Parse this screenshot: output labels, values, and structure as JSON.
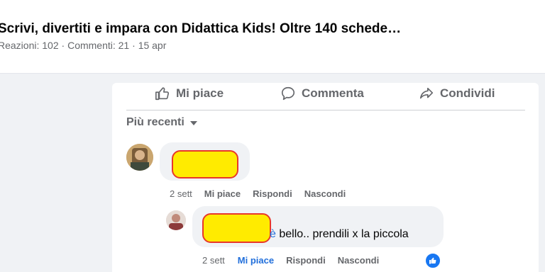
{
  "post": {
    "title": "Scrivi, divertiti e impara con Didattica Kids! Oltre 140 schede…",
    "reactions": "Reazioni: 102",
    "comments": "Commenti: 21",
    "date": "15 apr",
    "separator": "·"
  },
  "actions": {
    "like": "Mi piace",
    "comment": "Commenta",
    "share": "Condividi"
  },
  "sort": {
    "label": "Più recenti"
  },
  "comments": [
    {
      "time": "2 sett",
      "like": "Mi piace",
      "reply": "Rispondi",
      "hide": "Nascondi"
    },
    {
      "text_link_tail": "è",
      "text": " bello.. prendili x la piccola",
      "time": "2 sett",
      "like": "Mi piace",
      "reply": "Rispondi",
      "hide": "Nascondi",
      "liked_by_viewer": true
    }
  ],
  "colors": {
    "accent": "#216fdb",
    "redaction_fill": "#ffeb00",
    "redaction_border": "#e8372a"
  }
}
